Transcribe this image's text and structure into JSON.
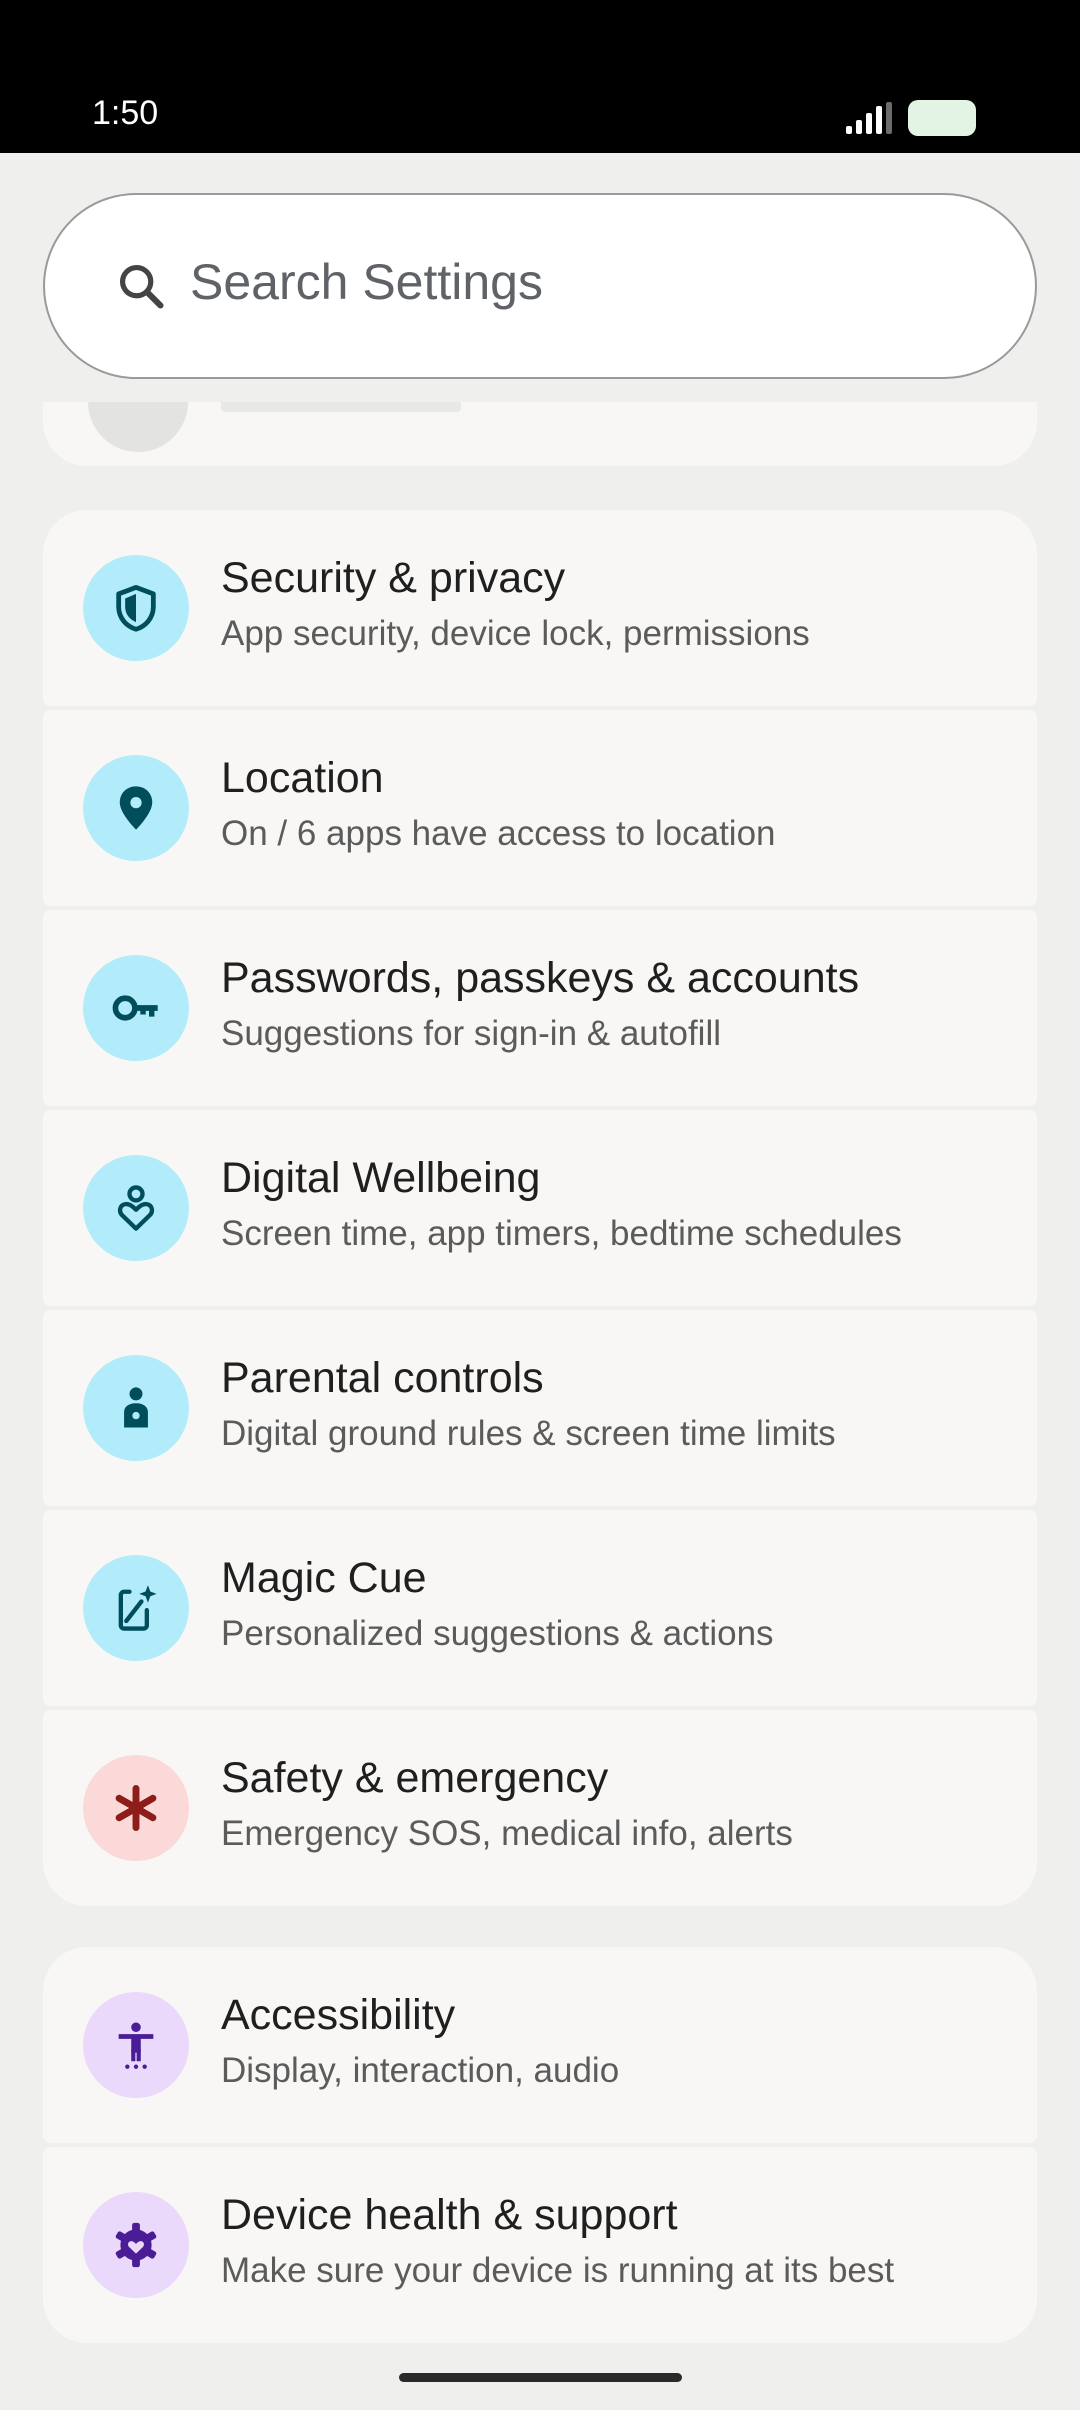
{
  "status_bar": {
    "time": "1:50"
  },
  "search": {
    "placeholder": "Search Settings"
  },
  "groups": [
    {
      "items": [
        {
          "title": "Security & privacy",
          "subtitle": "App security, device lock, permissions",
          "icon": "shield-icon"
        },
        {
          "title": "Location",
          "subtitle": "On / 6 apps have access to location",
          "icon": "location-pin-icon"
        },
        {
          "title": "Passwords, passkeys & accounts",
          "subtitle": "Suggestions for sign-in & autofill",
          "icon": "key-icon"
        },
        {
          "title": "Digital Wellbeing",
          "subtitle": "Screen time, app timers, bedtime schedules",
          "icon": "wellbeing-icon"
        },
        {
          "title": "Parental controls",
          "subtitle": "Digital ground rules & screen time limits",
          "icon": "child-icon"
        },
        {
          "title": "Magic Cue",
          "subtitle": "Personalized suggestions & actions",
          "icon": "magic-phone-icon"
        },
        {
          "title": "Safety & emergency",
          "subtitle": "Emergency SOS, medical info, alerts",
          "icon": "asterisk-icon"
        }
      ]
    },
    {
      "items": [
        {
          "title": "Accessibility",
          "subtitle": "Display, interaction, audio",
          "icon": "accessibility-icon"
        },
        {
          "title": "Device health & support",
          "subtitle": "Make sure your device is running at its best",
          "icon": "gear-heart-icon"
        }
      ]
    }
  ],
  "colors": {
    "teal_icon_bg": "#b2ecfb",
    "teal_icon_fg": "#004d5c",
    "safety_icon_bg": "#fbd9d8",
    "safety_icon_fg": "#8c1d18",
    "purple_icon_bg": "#ead9fb",
    "purple_icon_fg": "#4a1d96"
  }
}
